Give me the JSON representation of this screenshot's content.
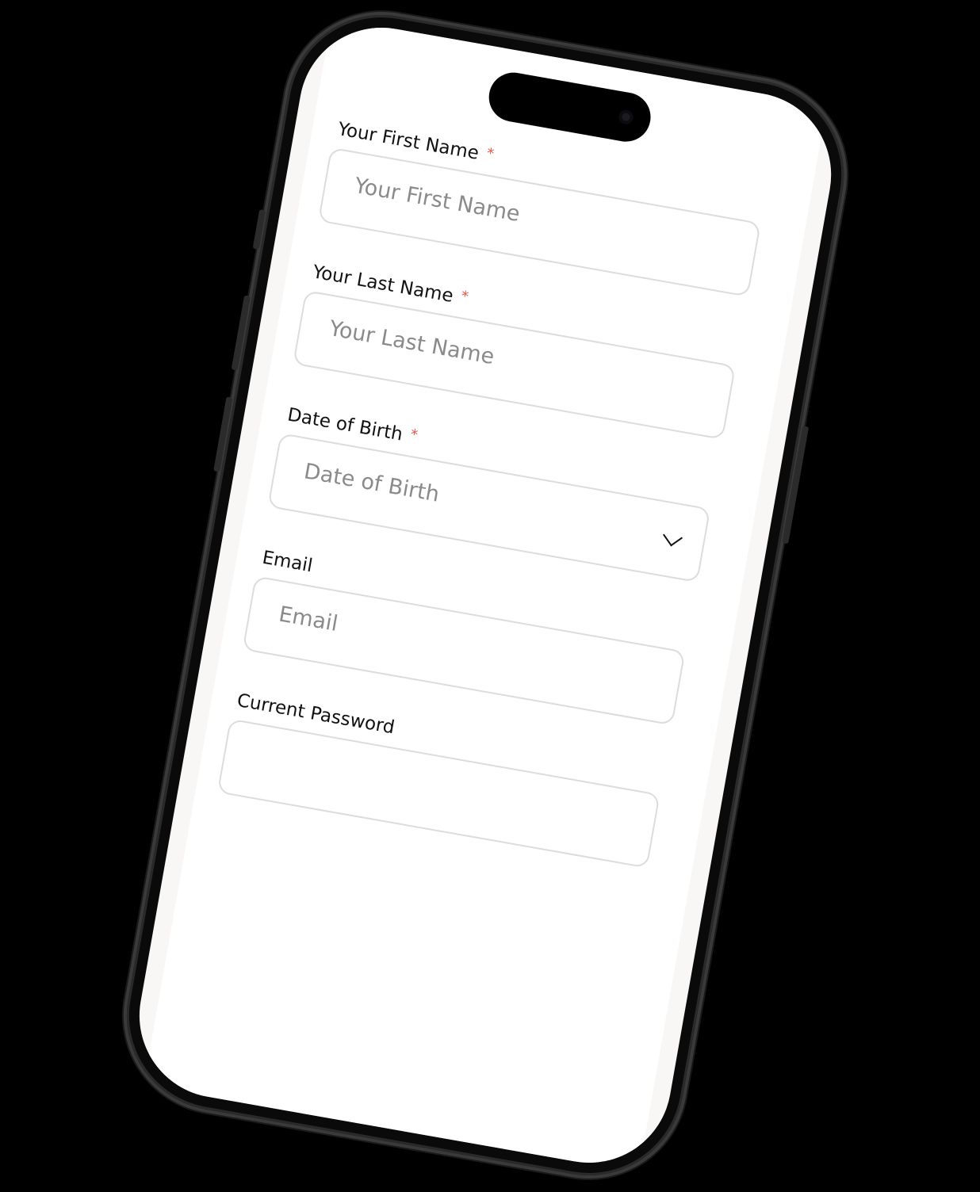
{
  "form": {
    "fields": [
      {
        "label": "Your First Name",
        "required_mark": "*",
        "placeholder": "Your First Name"
      },
      {
        "label": "Your Last Name",
        "required_mark": "*",
        "placeholder": "Your Last Name"
      },
      {
        "label": "Date of Birth",
        "required_mark": "*",
        "placeholder": "Date of Birth",
        "icon": "chevron-down-icon"
      },
      {
        "label": "Email",
        "placeholder": "Email"
      },
      {
        "label": "Current Password",
        "placeholder": ""
      }
    ]
  },
  "colors": {
    "required": "#e5534b",
    "border": "#dcdcdc",
    "placeholder": "#8a8a8a"
  }
}
